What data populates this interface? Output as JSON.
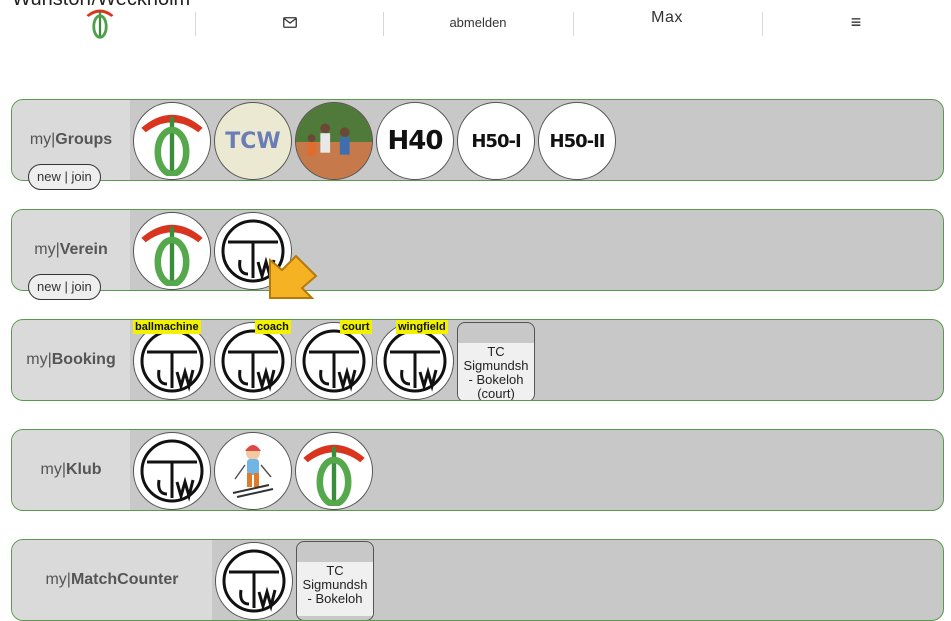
{
  "page": {
    "cut_title": "Wunstorf/Weckholm"
  },
  "nav": {
    "mail_icon": "mail-icon",
    "logout_label": "abmelden",
    "user_label": "Max",
    "menu_icon": "hamburger-menu-icon"
  },
  "sections": {
    "groups": {
      "prefix": "my|",
      "name": "Groups",
      "pill": "new | join",
      "items": [
        {
          "icon": "tp-logo"
        },
        {
          "text": "TCW"
        },
        {
          "icon": "tennis-photo"
        },
        {
          "text": "H40"
        },
        {
          "text": "H50-I"
        },
        {
          "text": "H50-II"
        }
      ]
    },
    "verein": {
      "prefix": "my|",
      "name": "Verein",
      "pill": "new | join",
      "items": [
        {
          "icon": "tp-logo"
        },
        {
          "icon": "tcw-club-logo"
        }
      ]
    },
    "booking": {
      "prefix": "my|",
      "name": "Booking",
      "tags": [
        "ballmachine",
        "coach",
        "court",
        "wingfield"
      ],
      "card": {
        "line1": "TC",
        "line2": "Sigmundsh",
        "line3": "- Bokeloh",
        "line4": "(court)"
      }
    },
    "klub": {
      "prefix": "my|",
      "name": "Klub",
      "items": [
        {
          "icon": "tcw-club-logo"
        },
        {
          "icon": "skier-icon"
        },
        {
          "icon": "tp-logo"
        }
      ]
    },
    "matchcounter": {
      "prefix": "my|",
      "name": "MatchCounter",
      "card": {
        "line1": "TC",
        "line2": "Sigmundsh",
        "line3": "- Bokeloh"
      }
    }
  },
  "colors": {
    "row_bg": "#c8c8c8",
    "row_border": "#5a9a4e",
    "label_bg": "#dadada",
    "tag_bg": "#f2f200",
    "pointer": "#f5b324"
  }
}
